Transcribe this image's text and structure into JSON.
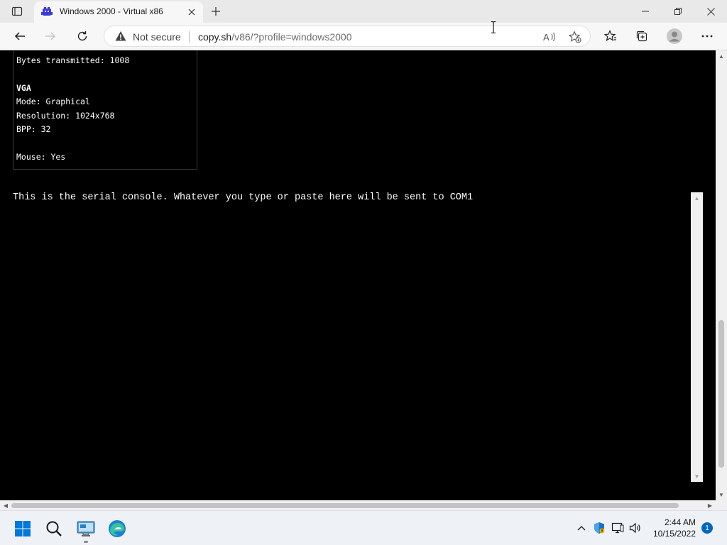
{
  "browser": {
    "tab_title": "Windows 2000 - Virtual x86",
    "security_label": "Not secure",
    "url_domain": "copy.sh",
    "url_path": "/v86/?profile=windows2000"
  },
  "info_panel": {
    "lines": [
      {
        "text": "Bytes transmitted: 1008"
      },
      {
        "text": "VGA"
      },
      {
        "text": "Mode: Graphical"
      },
      {
        "text": "Resolution: 1024x768"
      },
      {
        "text": "BPP: 32"
      },
      {
        "text": "Mouse: Yes"
      }
    ]
  },
  "serial_console": {
    "text": "This is the serial console. Whatever you type or paste here will be sent to COM1"
  },
  "taskbar": {
    "time": "2:44 AM",
    "date": "10/15/2022",
    "notification_count": "1"
  },
  "colors": {
    "accent": "#0067c0",
    "page_background": "#000000",
    "console_text": "#ffffff"
  }
}
